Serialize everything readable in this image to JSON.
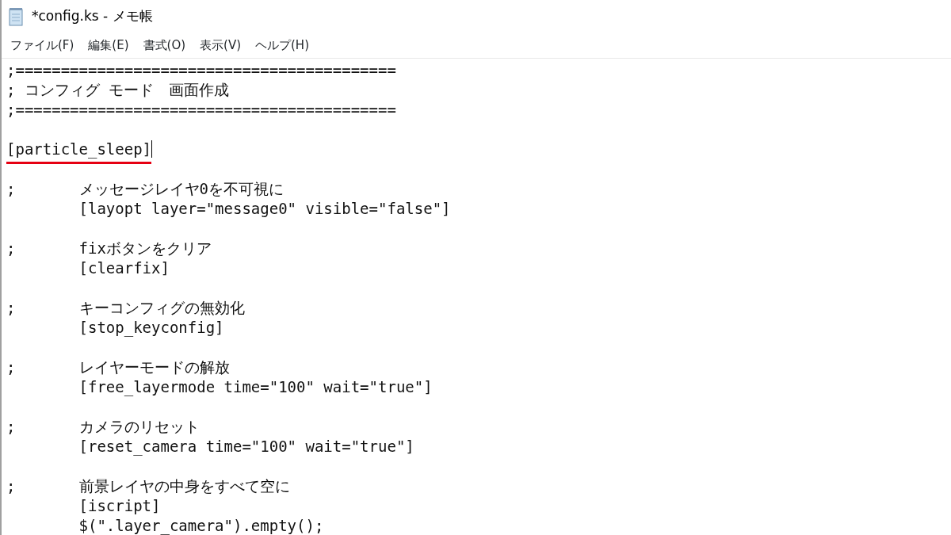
{
  "window": {
    "title": "*config.ks - メモ帳"
  },
  "menu": [
    {
      "label": "ファイル(F)"
    },
    {
      "label": "編集(E)"
    },
    {
      "label": "書式(O)"
    },
    {
      "label": "表示(V)"
    },
    {
      "label": "ヘルプ(H)"
    }
  ],
  "editor": {
    "blocks": [
      {
        "lines": [
          {
            "text": ";=========================================="
          },
          {
            "text": "; コンフィグ モード　画面作成"
          },
          {
            "text": ";=========================================="
          }
        ]
      },
      {
        "lines": [
          {
            "text": "[particle_sleep]",
            "underlined": true,
            "cursor": true
          }
        ]
      },
      {
        "lines": [
          {
            "text": ";\tメッセージレイヤ0を不可視に"
          },
          {
            "text": "\t[layopt layer=\"message0\" visible=\"false\"]"
          }
        ]
      },
      {
        "lines": [
          {
            "text": ";\tfixボタンをクリア"
          },
          {
            "text": "\t[clearfix]"
          }
        ]
      },
      {
        "lines": [
          {
            "text": ";\tキーコンフィグの無効化"
          },
          {
            "text": "\t[stop_keyconfig]"
          }
        ]
      },
      {
        "lines": [
          {
            "text": ";\tレイヤーモードの解放"
          },
          {
            "text": "\t[free_layermode time=\"100\" wait=\"true\"]"
          }
        ]
      },
      {
        "lines": [
          {
            "text": ";\tカメラのリセット"
          },
          {
            "text": "\t[reset_camera time=\"100\" wait=\"true\"]"
          }
        ]
      },
      {
        "lines": [
          {
            "text": ";\t前景レイヤの中身をすべて空に"
          },
          {
            "text": "\t[iscript]"
          },
          {
            "text": "\t$(\".layer_camera\").empty();"
          }
        ]
      }
    ]
  }
}
